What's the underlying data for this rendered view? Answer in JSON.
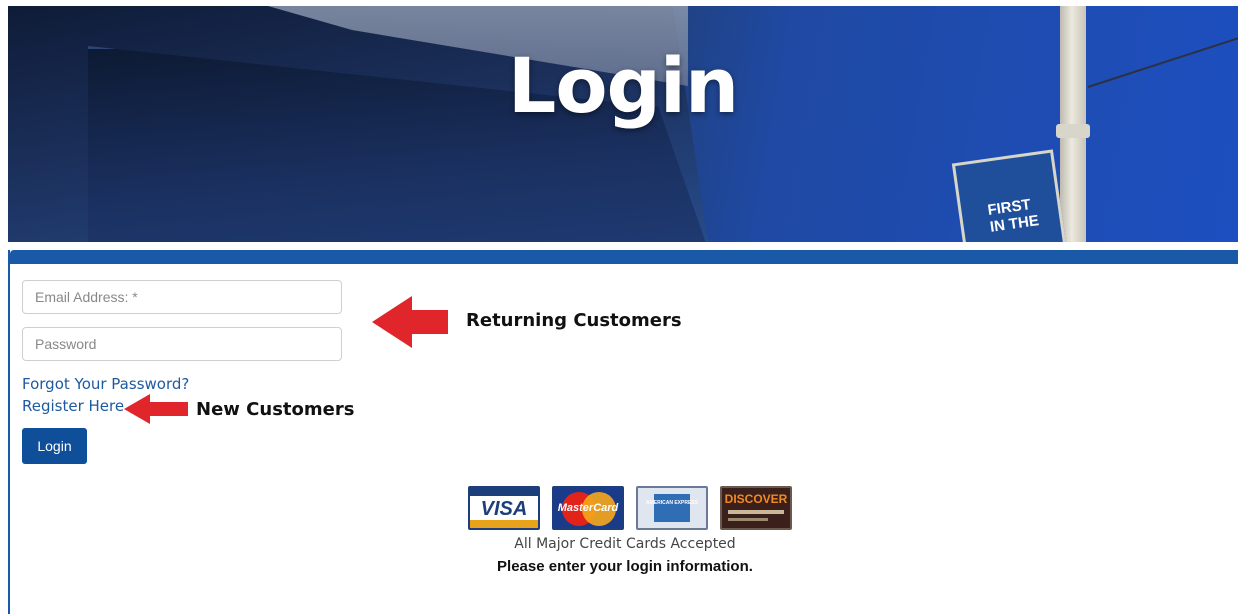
{
  "hero": {
    "title": "Login",
    "banner_text": "FIRST\nIN THE"
  },
  "login_form": {
    "email_placeholder": "Email Address: *",
    "password_placeholder": "Password",
    "forgot_link": "Forgot Your Password?",
    "register_link": "Register Here",
    "login_button": "Login"
  },
  "callouts": {
    "returning": "Returning Customers",
    "new": "New Customers"
  },
  "payment": {
    "cards": [
      {
        "label": "VISA",
        "icon": "visa-card-icon"
      },
      {
        "label": "MasterCard",
        "icon": "mastercard-icon"
      },
      {
        "label": "AMERICAN EXPRESS",
        "icon": "amex-card-icon"
      },
      {
        "label": "DISCOVER",
        "icon": "discover-card-icon"
      }
    ],
    "accepted_text": "All Major Credit Cards Accepted",
    "instruction": "Please enter your login information."
  },
  "colors": {
    "primary": "#1a59a8",
    "button": "#0f4f9a",
    "link": "#1e5aa0",
    "arrow": "#e0262b"
  }
}
